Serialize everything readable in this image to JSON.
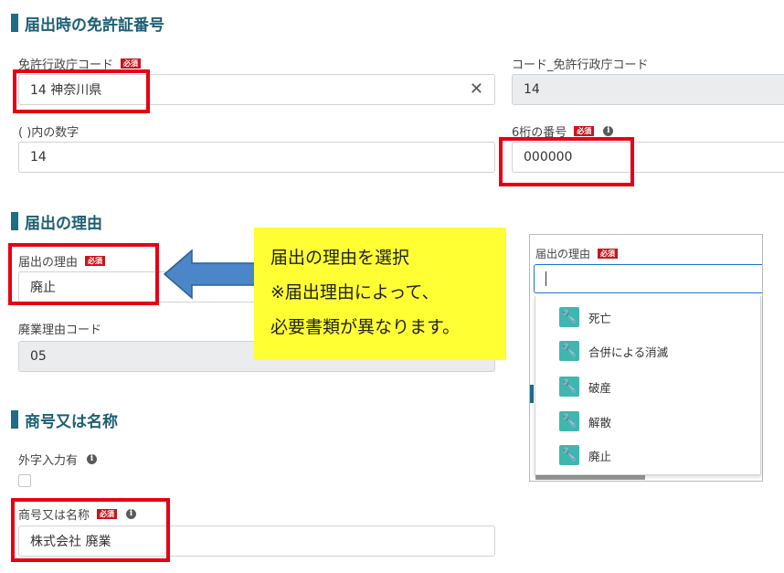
{
  "sections": {
    "license": "届出時の免許証番号",
    "reason": "届出の理由",
    "trade_name": "商号又は名称"
  },
  "fields": {
    "authority_code_label": "免許行政庁コード",
    "authority_code_value": "14 神奈川県",
    "authority_code_clear": "✕",
    "code_authority_label": "コード_免許行政庁コード",
    "code_authority_value": "14",
    "paren_number_label": "(  )内の数字",
    "paren_number_value": "14",
    "six_digit_label": "6桁の番号",
    "six_digit_value": "000000",
    "reason_label": "届出の理由",
    "reason_value": "廃止",
    "abolition_code_label": "廃業理由コード",
    "abolition_code_value": "05",
    "external_char_label": "外字入力有",
    "trade_name_label": "商号又は名称",
    "trade_name_value": "株式会社  廃業"
  },
  "required_badge": "必須",
  "info_icon_glyph": "i",
  "callout": {
    "line1": "届出の理由を選択",
    "line2": "※届出理由によって、",
    "line3": "必要書類が異なります。"
  },
  "dropdown": {
    "label": "届出の理由",
    "input_value": "",
    "options": [
      "死亡",
      "合併による消滅",
      "破産",
      "解散",
      "廃止"
    ]
  },
  "colors": {
    "accent": "#1d6d86",
    "required": "#c8161d",
    "highlight": "#e60012",
    "callout_bg": "#ffff33",
    "arrow": "#4a86c8",
    "option_icon": "#3fb7b0"
  },
  "icons": {
    "info": "info-icon",
    "clear": "close-icon",
    "option": "wrench-icon",
    "arrow": "left-arrow-icon"
  }
}
